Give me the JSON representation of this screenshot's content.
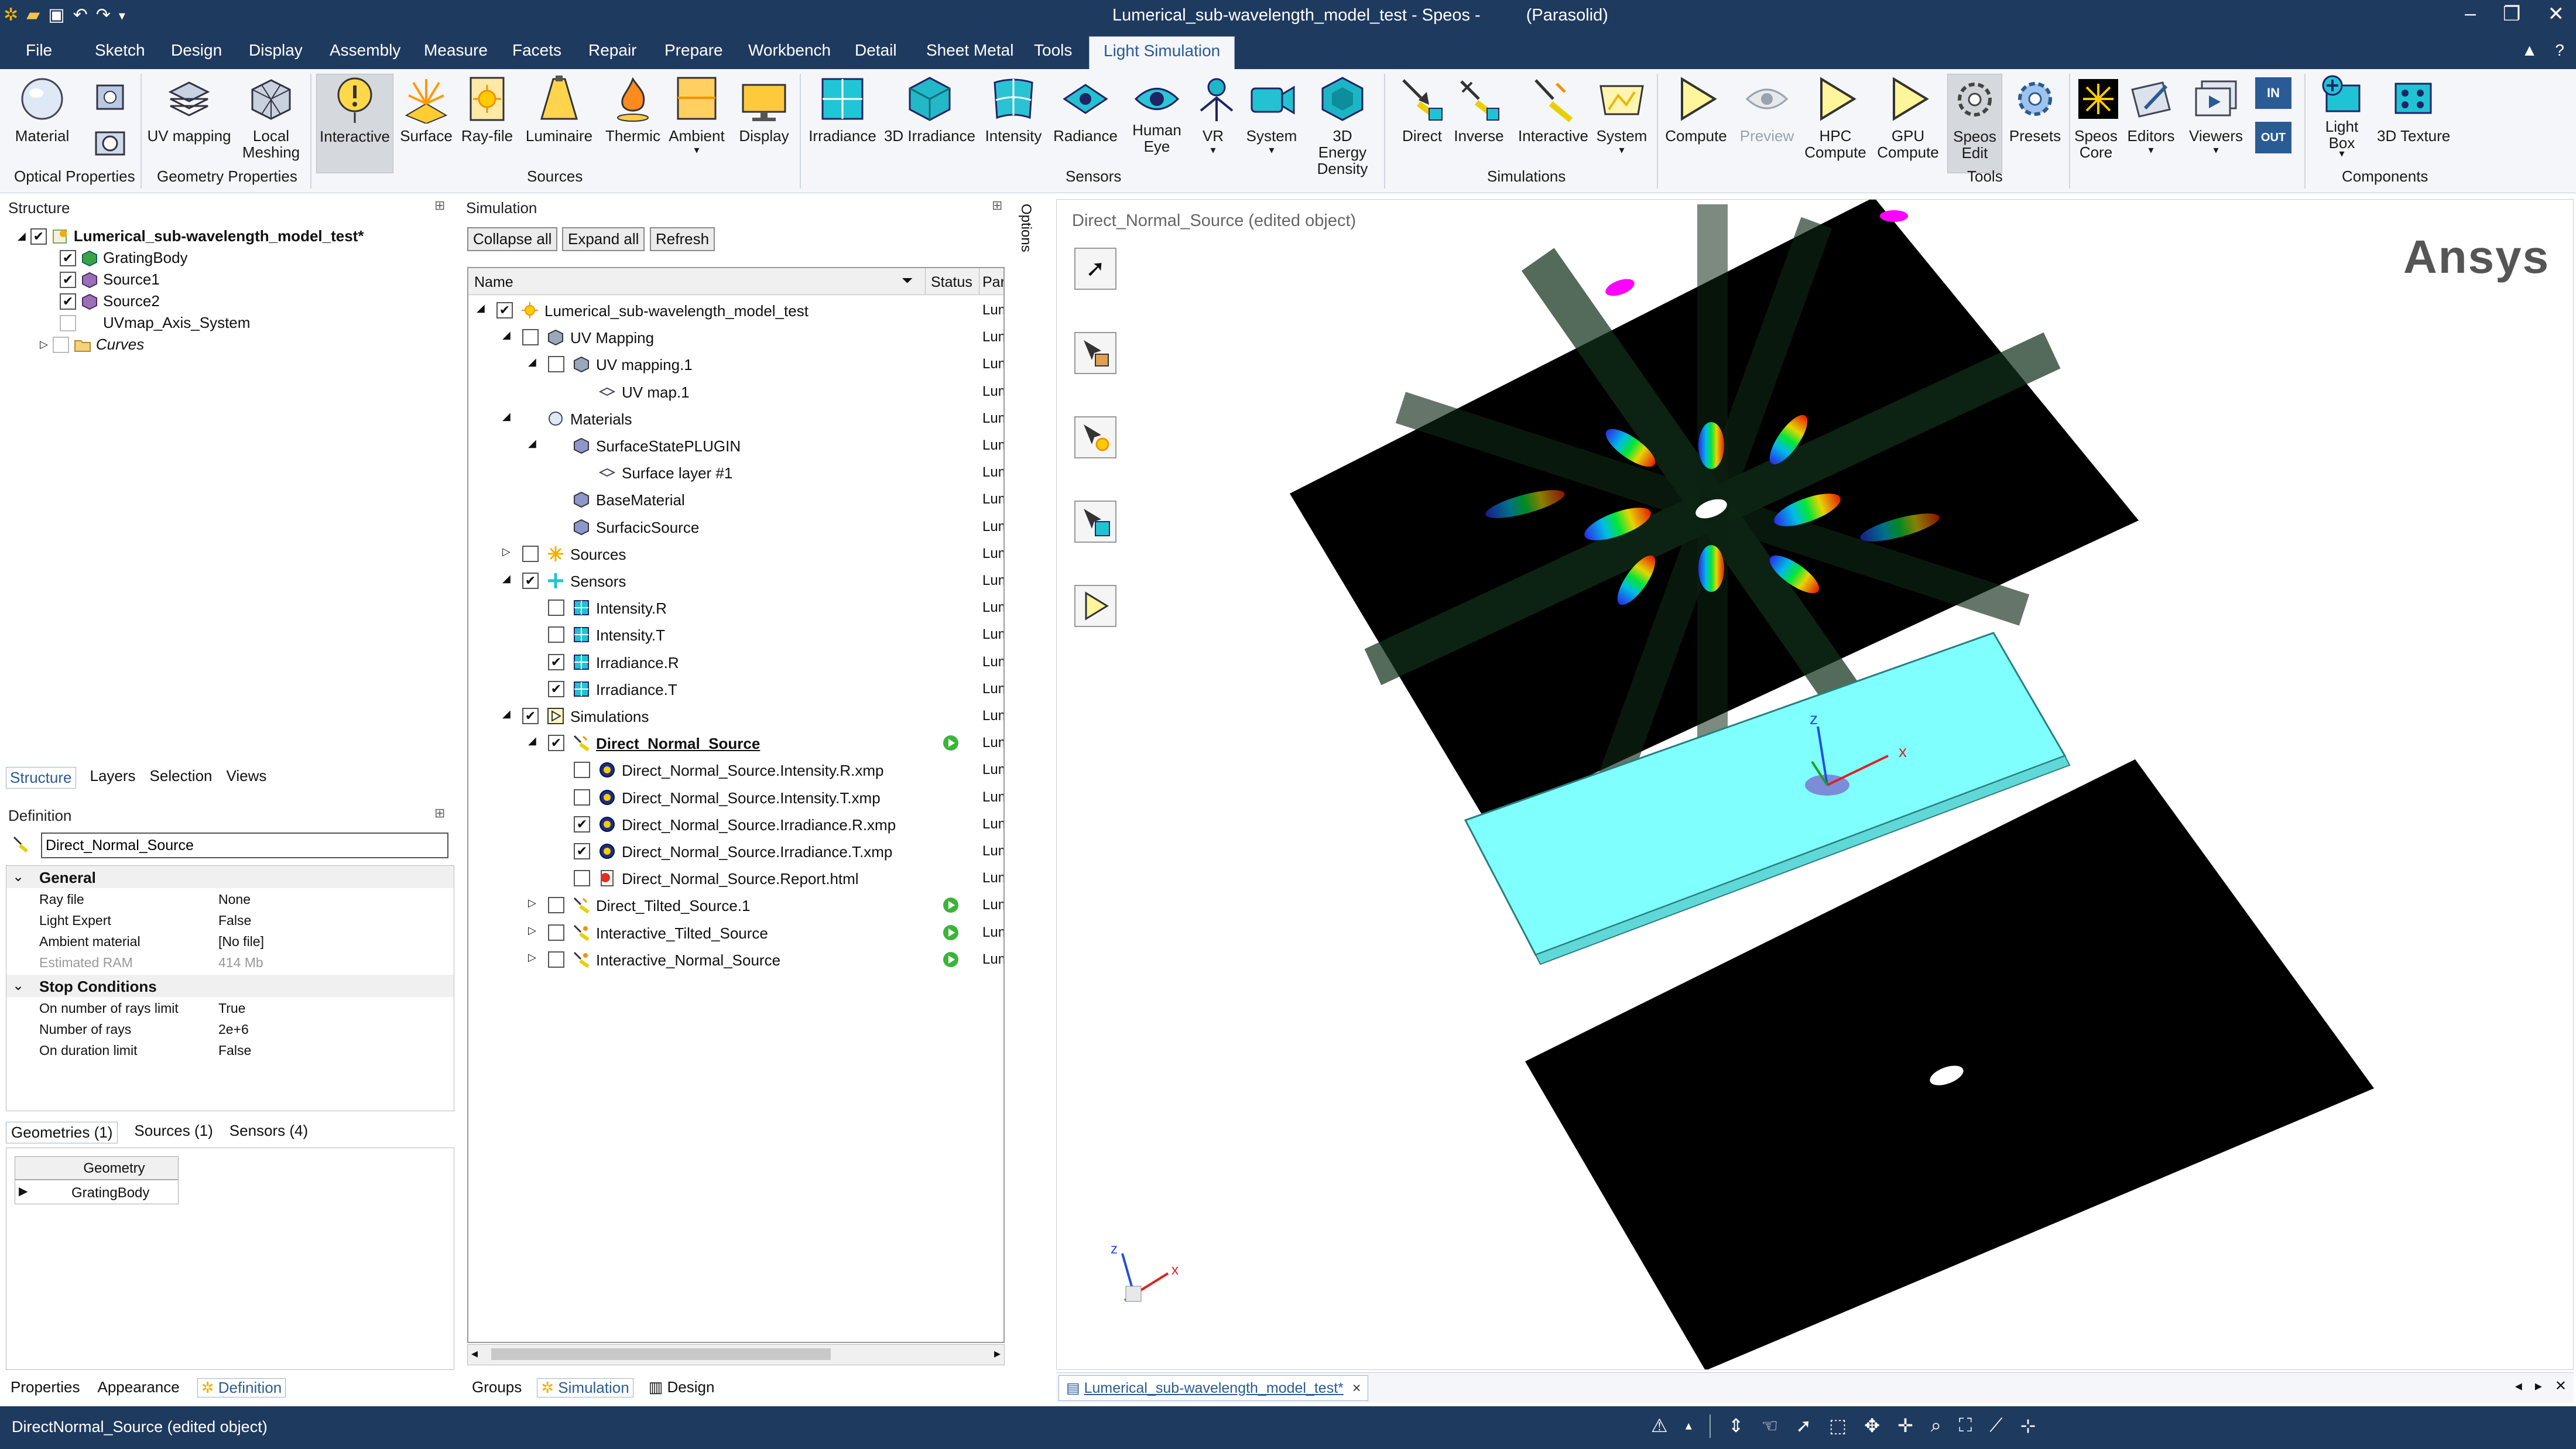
{
  "window": {
    "title": "Lumerical_sub-wavelength_model_test - Speos -",
    "title_extra": "(Parasolid)",
    "controls": [
      "–",
      "❐",
      "✕"
    ]
  },
  "menu": {
    "items": [
      "File",
      "Sketch",
      "Design",
      "Display",
      "Assembly",
      "Measure",
      "Facets",
      "Repair",
      "Prepare",
      "Workbench",
      "Detail",
      "Sheet Metal",
      "Tools",
      "Light Simulation"
    ],
    "active": "Light Simulation",
    "right": [
      "▲",
      "?"
    ]
  },
  "ribbon": {
    "buttons": [
      {
        "label": "Material",
        "icon": "material-sphere-icon"
      },
      {
        "label": "UV mapping",
        "icon": "uv-mapping-icon"
      },
      {
        "label": "Local\nMeshing",
        "icon": "local-meshing-icon"
      },
      {
        "label": "Interactive",
        "icon": "interactive-source-icon"
      },
      {
        "label": "Surface",
        "icon": "surface-source-icon"
      },
      {
        "label": "Ray-file",
        "icon": "ray-file-icon"
      },
      {
        "label": "Luminaire",
        "icon": "luminaire-icon"
      },
      {
        "label": "Thermic",
        "icon": "thermic-icon"
      },
      {
        "label": "Ambient",
        "icon": "ambient-icon"
      },
      {
        "label": "Display",
        "icon": "display-source-icon"
      },
      {
        "label": "Irradiance",
        "icon": "irradiance-sensor-icon"
      },
      {
        "label": "3D Irradiance",
        "icon": "3d-irradiance-icon"
      },
      {
        "label": "Intensity",
        "icon": "intensity-sensor-icon"
      },
      {
        "label": "Radiance",
        "icon": "radiance-sensor-icon"
      },
      {
        "label": "Human\nEye",
        "icon": "human-eye-icon"
      },
      {
        "label": "VR",
        "icon": "vr-icon"
      },
      {
        "label": "System",
        "icon": "camera-system-icon"
      },
      {
        "label": "3D Energy\nDensity",
        "icon": "3d-energy-density-icon"
      },
      {
        "label": "Direct",
        "icon": "direct-simulation-icon"
      },
      {
        "label": "Inverse",
        "icon": "inverse-simulation-icon"
      },
      {
        "label": "Interactive",
        "icon": "interactive-simulation-icon"
      },
      {
        "label": "System",
        "icon": "system-simulation-icon"
      },
      {
        "label": "Compute",
        "icon": "compute-play-icon"
      },
      {
        "label": "Preview",
        "icon": "preview-eye-icon"
      },
      {
        "label": "HPC\nCompute",
        "icon": "hpc-compute-icon"
      },
      {
        "label": "GPU\nCompute",
        "icon": "gpu-compute-icon"
      },
      {
        "label": "Speos\nEdit",
        "icon": "speos-edit-gear-icon"
      },
      {
        "label": "Presets",
        "icon": "presets-gear-icon"
      },
      {
        "label": "Speos\nCore",
        "icon": "speos-core-icon"
      },
      {
        "label": "Editors",
        "icon": "editors-icon"
      },
      {
        "label": "Viewers",
        "icon": "viewers-icon"
      },
      {
        "label": "Light\nBox",
        "icon": "light-box-icon"
      },
      {
        "label": "3D Texture",
        "icon": "3d-texture-icon"
      }
    ],
    "io_labels": [
      "IN",
      "OUT"
    ],
    "groups": [
      "Optical Properties",
      "Geometry Properties",
      "Sources",
      "Sensors",
      "Simulations",
      "Tools",
      "Components"
    ]
  },
  "structure": {
    "title": "Structure",
    "items": [
      {
        "label": "Lumerical_sub-wavelength_model_test*",
        "checked": true
      },
      {
        "label": "GratingBody",
        "checked": true
      },
      {
        "label": "Source1",
        "checked": true
      },
      {
        "label": "Source2",
        "checked": true
      },
      {
        "label": "UVmap_Axis_System",
        "checked": false
      },
      {
        "label": "Curves",
        "checked": false
      }
    ],
    "tabs": [
      "Structure",
      "Layers",
      "Selection",
      "Views"
    ]
  },
  "definition": {
    "title": "Definition",
    "name_value": "Direct_Normal_Source",
    "sections": [
      {
        "header": "General",
        "rows": [
          {
            "k": "Ray file",
            "v": "None"
          },
          {
            "k": "Light Expert",
            "v": "False"
          },
          {
            "k": "Ambient material",
            "v": "[No file]"
          },
          {
            "k": "Estimated RAM",
            "v": "414 Mb"
          }
        ]
      },
      {
        "header": "Stop Conditions",
        "rows": [
          {
            "k": "On number of rays limit",
            "v": "True"
          },
          {
            "k": "Number of rays",
            "v": "2e+6"
          },
          {
            "k": "On duration limit",
            "v": "False"
          }
        ]
      }
    ],
    "sub_tabs": [
      "Geometries (1)",
      "Sources (1)",
      "Sensors (4)"
    ],
    "geometry_header": "Geometry",
    "geometry_row": "GratingBody",
    "bottom_tabs": [
      "Properties",
      "Appearance",
      "Definition"
    ]
  },
  "simulation": {
    "title": "Simulation",
    "buttons": [
      "Collapse all",
      "Expand all",
      "Refresh"
    ],
    "columns": [
      "Name",
      "Status",
      "Par"
    ],
    "rows": [
      {
        "label": "Lumerical_sub-wavelength_model_test",
        "level": 0,
        "exp": "◢",
        "chk": "checked",
        "icon": "sun-icon",
        "col": "Lum"
      },
      {
        "label": "UV Mapping",
        "level": 1,
        "exp": "◢",
        "chk": "unchecked",
        "icon": "uv-cube-icon",
        "col": "Lum"
      },
      {
        "label": "UV mapping.1",
        "level": 2,
        "exp": "◢",
        "chk": "unchecked",
        "icon": "uv-cube-icon",
        "col": "Lum"
      },
      {
        "label": "UV map.1",
        "level": 3,
        "exp": "",
        "chk": "none",
        "icon": "diamond-icon",
        "col": "Lum"
      },
      {
        "label": "Materials",
        "level": 1,
        "exp": "◢",
        "chk": "none",
        "icon": "material-sphere-icon",
        "col": "Lum"
      },
      {
        "label": "SurfaceStatePLUGIN",
        "level": 2,
        "exp": "◢",
        "chk": "none",
        "icon": "material-cube-icon",
        "col": "Lum"
      },
      {
        "label": "Surface layer #1",
        "level": 3,
        "exp": "",
        "chk": "none",
        "icon": "diamond-icon",
        "col": "Lum"
      },
      {
        "label": "BaseMaterial",
        "level": 2,
        "exp": "",
        "chk": "none",
        "icon": "material-cube-icon",
        "col": "Lum"
      },
      {
        "label": "SurfacicSource",
        "level": 2,
        "exp": "",
        "chk": "none",
        "icon": "material-cube-icon",
        "col": "Lum"
      },
      {
        "label": "Sources",
        "level": 1,
        "exp": "▷",
        "chk": "unchecked",
        "icon": "sources-star-icon",
        "col": "Lum"
      },
      {
        "label": "Sensors",
        "level": 1,
        "exp": "◢",
        "chk": "checked",
        "icon": "sensors-grid-icon",
        "col": "Lum"
      },
      {
        "label": "Intensity.R",
        "level": 2,
        "exp": "",
        "chk": "unchecked",
        "icon": "sensor-grid-icon",
        "col": "Lum"
      },
      {
        "label": "Intensity.T",
        "level": 2,
        "exp": "",
        "chk": "unchecked",
        "icon": "sensor-grid-icon",
        "col": "Lum"
      },
      {
        "label": "Irradiance.R",
        "level": 2,
        "exp": "",
        "chk": "checked",
        "icon": "sensor-grid-icon",
        "col": "Lum"
      },
      {
        "label": "Irradiance.T",
        "level": 2,
        "exp": "",
        "chk": "checked",
        "icon": "sensor-grid-icon",
        "col": "Lum"
      },
      {
        "label": "Simulations",
        "level": 1,
        "exp": "◢",
        "chk": "checked",
        "icon": "simulations-play-icon",
        "col": "Lum"
      },
      {
        "label": "Direct_Normal_Source",
        "level": 2,
        "exp": "◢",
        "chk": "checked",
        "icon": "direct-sim-icon",
        "col": "Lum",
        "bold": true,
        "status": true
      },
      {
        "label": "Direct_Normal_Source.Intensity.R.xmp",
        "level": 3,
        "exp": "",
        "chk": "unchecked",
        "icon": "xmp-result-icon",
        "col": "Lum"
      },
      {
        "label": "Direct_Normal_Source.Intensity.T.xmp",
        "level": 3,
        "exp": "",
        "chk": "unchecked",
        "icon": "xmp-result-icon",
        "col": "Lum"
      },
      {
        "label": "Direct_Normal_Source.Irradiance.R.xmp",
        "level": 3,
        "exp": "",
        "chk": "checked",
        "icon": "xmp-result-icon",
        "col": "Lum"
      },
      {
        "label": "Direct_Normal_Source.Irradiance.T.xmp",
        "level": 3,
        "exp": "",
        "chk": "checked",
        "icon": "xmp-result-icon",
        "col": "Lum"
      },
      {
        "label": "Direct_Normal_Source.Report.html",
        "level": 3,
        "exp": "",
        "chk": "unchecked",
        "icon": "html-report-icon",
        "col": "Lum"
      },
      {
        "label": "Direct_Tilted_Source.1",
        "level": 2,
        "exp": "▷",
        "chk": "unchecked",
        "icon": "direct-sim-icon",
        "col": "Lum",
        "status": true
      },
      {
        "label": "Interactive_Tilted_Source",
        "level": 2,
        "exp": "▷",
        "chk": "unchecked",
        "icon": "interactive-sim-icon",
        "col": "Lum",
        "status": true
      },
      {
        "label": "Interactive_Normal_Source",
        "level": 2,
        "exp": "▷",
        "chk": "unchecked",
        "icon": "interactive-sim-icon",
        "col": "Lum",
        "status": true
      }
    ],
    "bottom_tabs": [
      "Groups",
      "Simulation",
      "Design"
    ]
  },
  "options": {
    "label": "Options"
  },
  "viewport": {
    "header": "Direct_Normal_Source (edited object)",
    "logo": "Ansys",
    "doc_tab": "Lumerical_sub-wavelength_model_test*",
    "doc_tab_close": "×",
    "axes": {
      "x": "x",
      "z": "z"
    },
    "colors": {
      "sensor_plane": "#000000",
      "grating": "#80ffff",
      "source_marker": "#ff00ff"
    }
  },
  "statusbar": {
    "text": "DirectNormal_Source (edited object)"
  }
}
